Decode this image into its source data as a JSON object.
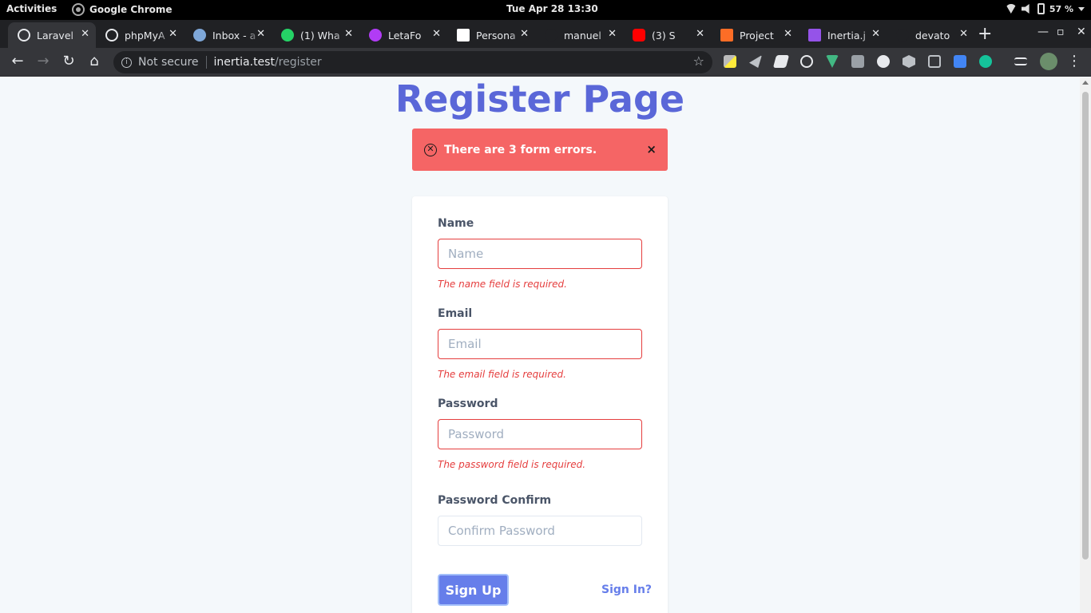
{
  "system_bar": {
    "activities": "Activities",
    "app_name": "Google Chrome",
    "clock": "Tue Apr 28  13:30",
    "battery": "57 %"
  },
  "browser": {
    "tabs": [
      {
        "label": "Laravel",
        "favicon_color": "#ffffff",
        "active": true
      },
      {
        "label": "phpMyA",
        "favicon_color": "#ffffff"
      },
      {
        "label": "Inbox - a",
        "favicon_color": "#7ea7d8"
      },
      {
        "label": "(1) Wha",
        "favicon_color": "#25d366"
      },
      {
        "label": "LetaFo",
        "favicon_color": "#b13cf5"
      },
      {
        "label": "Persona",
        "favicon_color": "#ffffff"
      },
      {
        "label": "manuel",
        "favicon_color": "#202124"
      },
      {
        "label": "(3) S",
        "favicon_color": "#ff0000"
      },
      {
        "label": "Project",
        "favicon_color": "#fc6d26"
      },
      {
        "label": "Inertia.j",
        "favicon_color": "#9553e9"
      },
      {
        "label": "devato",
        "favicon_color": "#202124"
      }
    ],
    "new_tab": "+",
    "security_label": "Not secure",
    "url_host": "inertia.test",
    "url_path": "/register"
  },
  "page": {
    "title": "Register Page",
    "alert": {
      "message": "There are 3 form errors.",
      "dismiss": "×"
    },
    "form": {
      "name": {
        "label": "Name",
        "placeholder": "Name",
        "error": "The name field is required."
      },
      "email": {
        "label": "Email",
        "placeholder": "Email",
        "error": "The email field is required."
      },
      "password": {
        "label": "Password",
        "placeholder": "Password",
        "error": "The password field is required."
      },
      "password_confirm": {
        "label": "Password Confirm",
        "placeholder": "Confirm Password"
      },
      "submit_label": "Sign Up",
      "signin_link": "Sign In?"
    }
  },
  "colors": {
    "accent": "#5a67d8",
    "button": "#667eea",
    "alert_bg": "#f56565",
    "error": "#e53e3e"
  }
}
